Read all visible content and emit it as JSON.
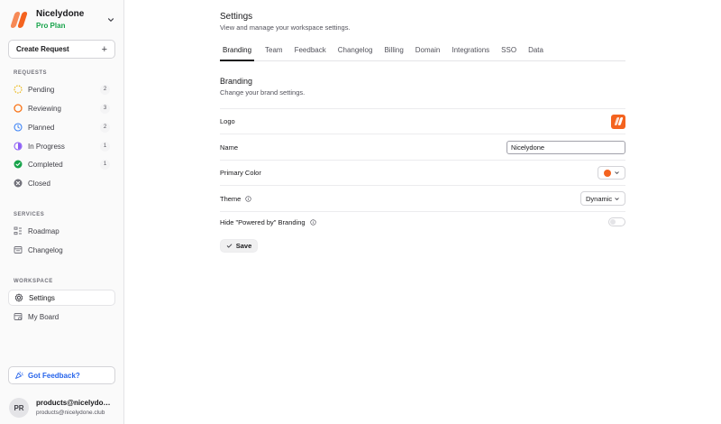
{
  "org": {
    "name": "Nicelydone",
    "plan": "Pro Plan"
  },
  "create_request": {
    "label": "Create Request",
    "icon": "plus-icon"
  },
  "sections": {
    "requests": "REQUESTS",
    "services": "SERVICES",
    "workspace": "WORKSPACE"
  },
  "requests": [
    {
      "label": "Pending",
      "count": "2",
      "icon": "pending-status-icon",
      "color": "#eab308"
    },
    {
      "label": "Reviewing",
      "count": "3",
      "icon": "reviewing-status-icon",
      "color": "#f97316"
    },
    {
      "label": "Planned",
      "count": "2",
      "icon": "planned-clock-icon",
      "color": "#3b82f6"
    },
    {
      "label": "In Progress",
      "count": "1",
      "icon": "in-progress-icon",
      "color": "#8b5cf6"
    },
    {
      "label": "Completed",
      "count": "1",
      "icon": "completed-check-icon",
      "color": "#16a34a"
    },
    {
      "label": "Closed",
      "count": "",
      "icon": "closed-x-icon",
      "color": "#71717a"
    }
  ],
  "services": [
    {
      "label": "Roadmap",
      "icon": "roadmap-icon"
    },
    {
      "label": "Changelog",
      "icon": "changelog-icon"
    }
  ],
  "workspace": [
    {
      "label": "Settings",
      "icon": "gear-icon"
    },
    {
      "label": "My Board",
      "icon": "board-icon"
    }
  ],
  "feedback": {
    "label": "Got Feedback?",
    "icon": "megaphone-icon"
  },
  "user": {
    "initials": "PR",
    "name": "products@nicelydone....",
    "email": "products@nicelydone.club"
  },
  "page": {
    "title": "Settings",
    "subtitle": "View and manage your workspace settings."
  },
  "tabs": [
    "Branding",
    "Team",
    "Feedback",
    "Changelog",
    "Billing",
    "Domain",
    "Integrations",
    "SSO",
    "Data"
  ],
  "branding": {
    "title": "Branding",
    "subtitle": "Change your brand settings.",
    "logo_label": "Logo",
    "name_label": "Name",
    "name_value": "Nicelydone",
    "primary_color_label": "Primary Color",
    "primary_color": "#f4631f",
    "theme_label": "Theme",
    "theme_value": "Dynamic",
    "powered_by_label": "Hide \"Powered by\" Branding",
    "powered_by_enabled": false,
    "save_label": "Save"
  }
}
